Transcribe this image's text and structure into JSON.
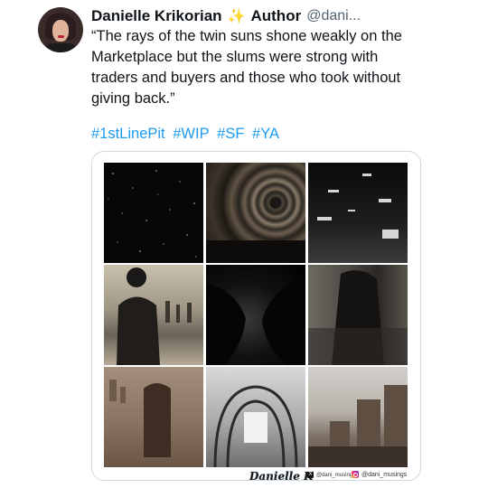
{
  "tweet": {
    "display_name": "Danielle Krikorian",
    "badge_icon": "sparkles-icon",
    "badge_label": "Author",
    "handle": "@dani...",
    "body": "“The rays of the twin suns shone weakly on the Marketplace but the slums were strong with traders and buyers and those who took without giving back.”",
    "hashtags": [
      "#1stLinePit",
      "#WIP",
      "#SF",
      "#YA"
    ]
  },
  "media": {
    "watermark_signature": "Danielle K",
    "x_handle": "@dani_musings",
    "instagram_handle": "@dani_musings"
  },
  "colors": {
    "link": "#1d9bf0",
    "secondary_text": "#536471",
    "primary_text": "#0f1419"
  }
}
